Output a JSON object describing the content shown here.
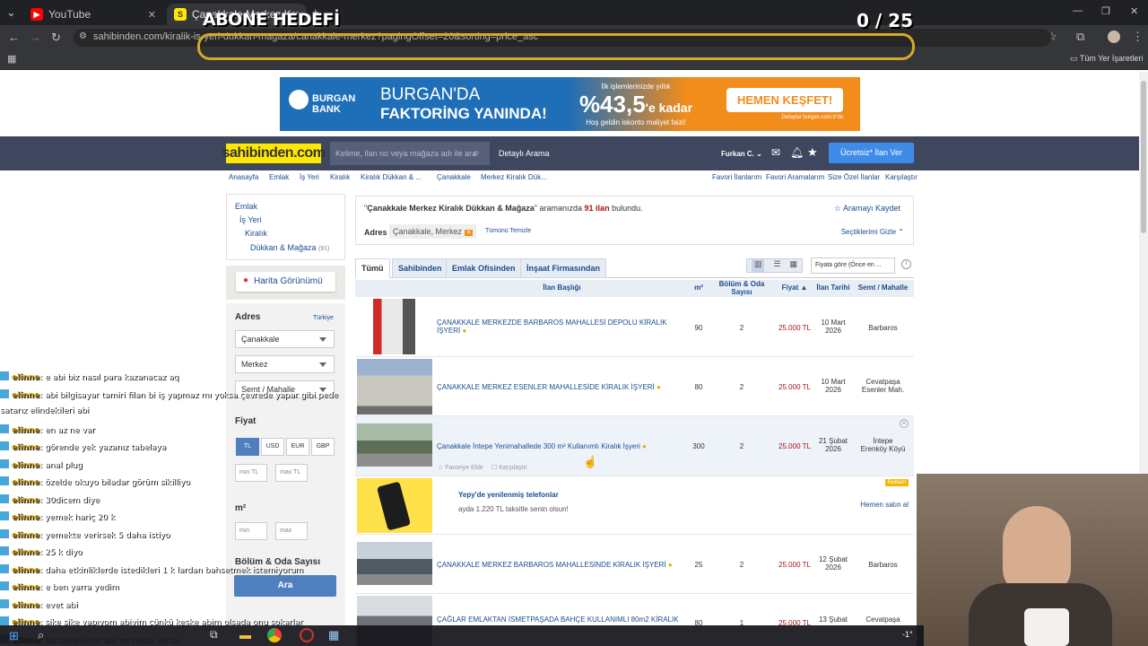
{
  "browser": {
    "tabs": [
      {
        "title": "YouTube",
        "active": false
      },
      {
        "title": "Çanakkale Merkez Kiralık Dükk",
        "active": true
      }
    ],
    "url": "sahibinden.com/kiralik-is-yeri-dukkan-magaza/canakkale-merkez?pagingOffset=20&sorting=price_asc",
    "bookmark_all": "Tüm Yer İşaretleri"
  },
  "overlay": {
    "goal_label": "ABONE HEDEFİ",
    "goal_counter": "0 / 25"
  },
  "banner": {
    "brand": "BURGAN BANK",
    "headline1": "BURGAN'DA",
    "headline2": "FAKTORİNG YANINDA!",
    "promo_top": "İlk işlemlerinizde yıllık",
    "promo_pct": "%43,5",
    "promo_suffix": "'e kadar",
    "promo_bottom": "Hoş geldin iskonto maliyet faizi!",
    "cta": "HEMEN KEŞFET!",
    "fine": "Detaylar burgan.com.tr'de"
  },
  "site_header": {
    "logo": "sahibinden.com",
    "search_placeholder": "Kelime, ilan no veya mağaza adı ile ara",
    "detailed_search": "Detaylı Arama",
    "user": "Furkan C.",
    "post_ad": "Ücretsiz* İlan Ver"
  },
  "breadcrumbs": [
    "Anasayfa",
    "Emlak",
    "İş Yeri",
    "Kiralık",
    "Kiralık Dükkan & ...",
    "Çanakkale",
    "Merkez Kiralık Dük..."
  ],
  "top_links": [
    "Favori İlanlarım",
    "Favori Aramalarım",
    "Size Özel İlanlar",
    "Karşılaştır"
  ],
  "category_tree": [
    {
      "label": "Emlak"
    },
    {
      "label": "İş Yeri"
    },
    {
      "label": "Kiralık"
    },
    {
      "label": "Dükkan & Mağaza",
      "count": "(91)"
    }
  ],
  "map_view": "Harita Görünümü",
  "filters": {
    "address_title": "Adres",
    "address_country": "Türkiye",
    "city": "Çanakkale",
    "district": "Merkez",
    "neighborhood": "Semt / Mahalle",
    "price_title": "Fiyat",
    "currencies": [
      "TL",
      "USD",
      "EUR",
      "GBP"
    ],
    "min_tl": "min TL",
    "max_tl": "max TL",
    "area_title": "m²",
    "min": "min",
    "max": "max",
    "rooms_title": "Bölüm & Oda Sayısı",
    "search_button": "Ara"
  },
  "results": {
    "query": "Çanakkale Merkez Kiralık Dükkan & Mağaza",
    "search_suffix": "aramanızda",
    "count": "91 ilan",
    "found": "bulundu.",
    "save_search": "Aramayı Kaydet",
    "address_label": "Adres",
    "address_chip": "Çanakkale, Merkez",
    "clear_all": "Tümünü Temizle",
    "hide_selection": "Seçtiklerimi Gizle"
  },
  "listing_tabs": [
    "Tümü",
    "Sahibinden",
    "Emlak Ofisinden",
    "İnşaat Firmasından"
  ],
  "sort_label": "Fiyata göre (Önce en ...",
  "columns": [
    "İlan Başlığı",
    "m²",
    "Bölüm & Oda Sayısı",
    "Fiyat",
    "İlan Tarihi",
    "Semt / Mahalle"
  ],
  "listings": [
    {
      "title": "ÇANAKKALE MERKEZDE BARBAROS MAHALLESİ DEPOLU KİRALIK İŞYERİ",
      "m2": "90",
      "rooms": "2",
      "price": "25.000 TL",
      "date1": "10 Mart",
      "date2": "2026",
      "loc1": "Barbaros",
      "loc2": ""
    },
    {
      "title": "ÇANAKKALE MERKEZ ESENLER MAHALLESİDE KİRALIK İŞYERİ",
      "m2": "80",
      "rooms": "2",
      "price": "25.000 TL",
      "date1": "10 Mart",
      "date2": "2026",
      "loc1": "Cevatpaşa",
      "loc2": "Esenler Mah."
    },
    {
      "title": "Çanakkale İntepe Yenimahallede 300 m² Kullanımlı Kiralık İşyeri",
      "m2": "300",
      "rooms": "2",
      "price": "25.000 TL",
      "date1": "21 Şubat",
      "date2": "2026",
      "loc1": "İntepe",
      "loc2": "Erenköy Köyü",
      "fav": "Favoriye Ekle",
      "compare": "Karşılaştır"
    },
    {
      "title": "ÇANAKKALE MERKEZ BARBAROS MAHALLESİNDE KİRALIK İŞYERİ",
      "m2": "25",
      "rooms": "2",
      "price": "25.000 TL",
      "date1": "12 Şubat",
      "date2": "2026",
      "loc1": "Barbaros",
      "loc2": ""
    },
    {
      "title": "ÇAĞLAR EMLAKTAN İSMETPAŞADA BAHÇE KULLANIMLI 80m2 KİRALIK",
      "m2": "80",
      "rooms": "1",
      "price": "25.000 TL",
      "date1": "13 Şubat",
      "date2": "",
      "loc1": "Cevatpaşa",
      "loc2": ""
    }
  ],
  "ad": {
    "title": "Yepy'de yenilenmiş telefonlar",
    "subtitle": "ayda 1.220 TL taksitle senin olsun!",
    "badge": "Reklam",
    "cta": "Hemen satın al"
  },
  "chat": [
    {
      "user": "elinne",
      "msg": ": e abi biz nasıl para kazanacaz aq"
    },
    {
      "user": "elinne",
      "msg": ": abi bilgisayar tamiri filan bi iş yapmaz mı yoksa çevrede yapar gibi pede"
    },
    {
      "user": "",
      "msg": "satarız elindekileri abi"
    },
    {
      "user": "elinne",
      "msg": ": en az ne var"
    },
    {
      "user": "elinne",
      "msg": ": görende yek yazanız tabelaya"
    },
    {
      "user": "elinne",
      "msg": ": anal plug"
    },
    {
      "user": "elinne",
      "msg": ": özelde okuyo biladar görüm sikilliyo"
    },
    {
      "user": "elinne",
      "msg": ": 30dicem diye"
    },
    {
      "user": "elinne",
      "msg": ": yemek hariç 20 k"
    },
    {
      "user": "elinne",
      "msg": ": yemekte verirsek 5 daha istiyo"
    },
    {
      "user": "elinne",
      "msg": ": 25 k diyo"
    },
    {
      "user": "elinne",
      "msg": ": daha etkinliklerde istedikleri 1 k lardan bahsetmek istemiyorum"
    },
    {
      "user": "elinne",
      "msg": ": e ben yarra yedim"
    },
    {
      "user": "elinne",
      "msg": ": evet abi"
    },
    {
      "user": "elinne",
      "msg": ": sike sike yapıyom abiyim cünkü keşke abim olsada onu sokarlar"
    },
    {
      "user": "elinne",
      "msg": ": biz sürünüyoz abi ne nefse alırsa."
    }
  ],
  "taskbar": {
    "weather": "-1°"
  }
}
